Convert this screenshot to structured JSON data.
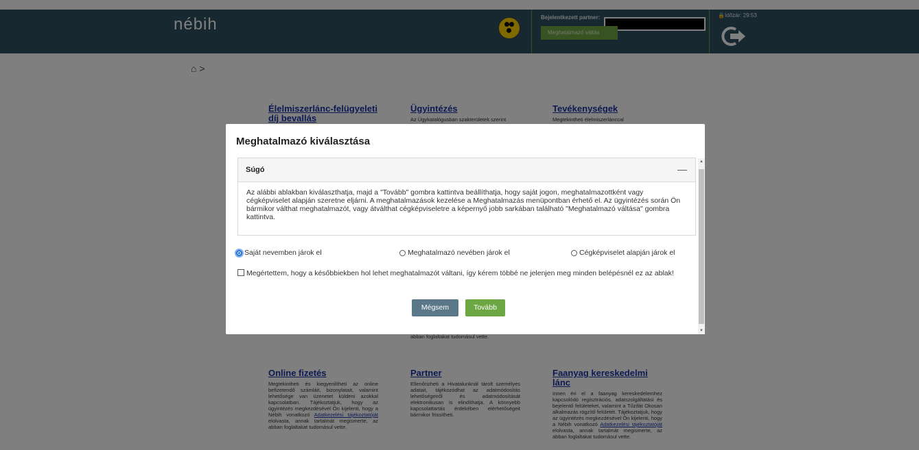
{
  "header": {
    "logo_text": "nébih",
    "partner_label": "Bejelentkezett partner:",
    "switch_button": "Meghatalmazó váltás",
    "timer": "Időzár: 29:53"
  },
  "breadcrumb": {
    "home_icon": "home-icon",
    "separator": ">"
  },
  "tiles": [
    {
      "title": "Élelmiszerlánc-felügyeleti díj bevallás",
      "text": ""
    },
    {
      "title": "Ügyintézés",
      "text": "Az Ügykatalógusban szakterületek szerint"
    },
    {
      "title": "Tevékenységek",
      "text": "Megtekintheti élelmiszerlánccal"
    },
    {
      "title": "",
      "text": "abban foglaltakat tudomásul vette."
    },
    {
      "title": "Online fizetés",
      "text": "Megtekintheti és kiegyenlítheti az online befizetendő számláit, bizonylatait, valamint lehetősége van üzenetet küldeni azokkal kapcsolatban. Tájékoztatjuk, hogy az ügyintézés megkezdésével Ön kijelenti, hogy a Nébih vonatkozó",
      "link": "Adatkezelési tájékoztatóját",
      "text2": "elolvasta, annak tartalmát megismerte, az abban foglaltakat tudomásul vette."
    },
    {
      "title": "Partner",
      "text": "Ellenőrizheti a Hivatalunknál tárolt személyes adatait, tájékozódhat az adatmódosítás lehetőségeiről és adatmódosítását elektronikusan is elindíthatja. A könnyebb kapcsolattartás érdekében elérhetőségeit bármikor frissítheti."
    },
    {
      "title": "Faanyag kereskedelmi lánc",
      "text": "Innen éri el a faanyag kereskedelemhez kapcsolódó regisztrációs, adatszolgáltatási és bejelentő felületeket, valamint a Tűzifát Okosan alkalmazás rögzítő felületét. Tájékoztatjuk, hogy az ügyintézés megkezdésével Ön kijelenti, hogy a Nébih vonatkozó",
      "link": "Adatkezelési tájékoztatóját",
      "text2": "elolvasta, annak tartalmát megismerte, az abban foglaltakat tudomásul vette."
    }
  ],
  "modal": {
    "title": "Meghatalmazó kiválasztása",
    "help_title": "Súgó",
    "help_toggle": "—",
    "help_text": "Az alábbi ablakban kiválaszthatja, majd a \"Tovább\" gombra kattintva beállíthatja, hogy saját jogon, meghatalmazottként vagy cégképviselet alapján szeretne eljárni. A meghatalmazások kezelése a Meghatalmazás menüpontban érhető el. Az ügyintézés során Ön bármikor válthat meghatalmazót, vagy átválthat cégképviseletre a képernyő jobb sarkában található \"Meghatalmazó váltása\" gombra kattintva.",
    "options": [
      {
        "label": "Saját nevemben járok el",
        "selected": true
      },
      {
        "label": "Meghatalmazó nevében járok el",
        "selected": false
      },
      {
        "label": "Cégképviselet alapján járok el",
        "selected": false
      }
    ],
    "ack_text": "Megértettem, hogy a későbbiekben hol lehet meghatalmazót váltani, így kérem többé ne jelenjen meg minden belépésnél ez az ablak!",
    "cancel_label": "Mégsem",
    "next_label": "Tovább"
  },
  "colors": {
    "header_bg": "#2f5163",
    "accent_green": "#6ca743",
    "cancel_bg": "#5a7888",
    "link": "#1a35a8"
  }
}
